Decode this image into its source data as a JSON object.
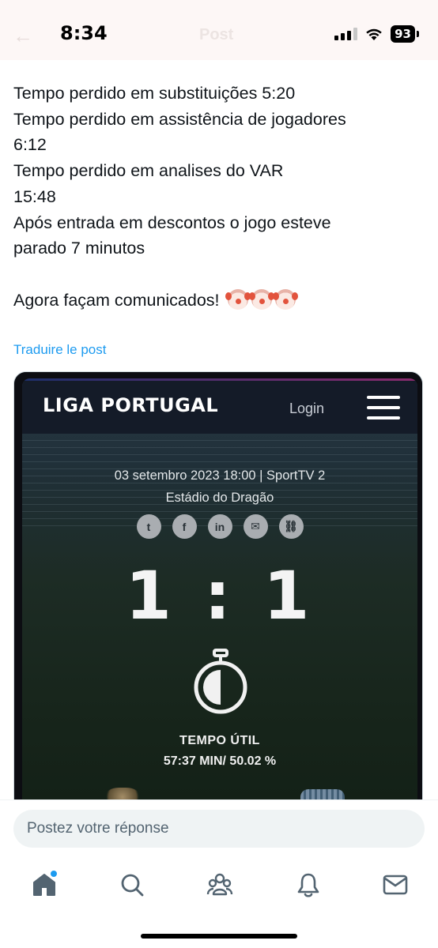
{
  "status_bar": {
    "time": "8:34",
    "battery": "93",
    "ghost_title": "Post",
    "ghost_back": "←"
  },
  "tweet": {
    "lines": [
      "Tempo perdido em substituições 5:20",
      "Tempo perdido em assistência de jogadores",
      "6:12",
      "Tempo perdido em analises do VAR",
      "15:48",
      "Após entrada em descontos o jogo esteve",
      "parado 7 minutos"
    ],
    "closing": "Agora façam comunicados!",
    "emoji": [
      "clown-face",
      "clown-face",
      "clown-face"
    ],
    "translate_label": "Traduire le post"
  },
  "media": {
    "site_logo": "LIGA PORTUGAL",
    "login_label": "Login",
    "match_date": "03 setembro 2023 18:00 | SportTV 2",
    "venue": "Estádio do Dragão",
    "share_icons": [
      "twitter-icon",
      "facebook-icon",
      "linkedin-icon",
      "email-icon",
      "link-icon"
    ],
    "share_glyphs": [
      "t",
      "f",
      "in",
      "✉",
      "⛓"
    ],
    "score": "1 : 1",
    "tempo_label": "TEMPO ÚTIL",
    "tempo_value": "57:37 MIN/ 50.02 %",
    "stopwatch_fill": 0.5002
  },
  "reply": {
    "placeholder": "Postez votre réponse"
  },
  "nav": {
    "items": [
      "home",
      "search",
      "communities",
      "notifications",
      "messages"
    ],
    "home_has_badge": true
  },
  "colors": {
    "accent": "#1d9bf0",
    "text": "#0f1419",
    "input_bg": "#eff3f4"
  }
}
